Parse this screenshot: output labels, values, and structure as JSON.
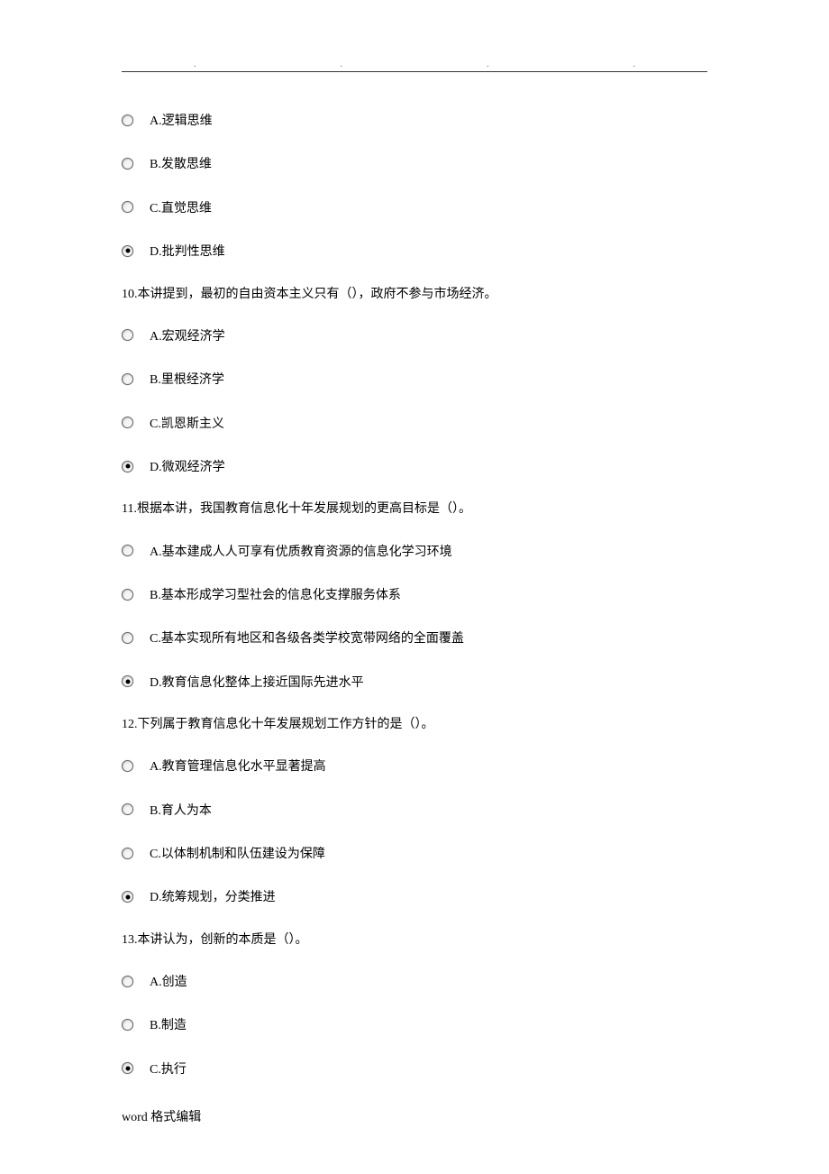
{
  "header_dots": [
    ".",
    ".",
    ".",
    "."
  ],
  "questions": [
    {
      "text": "",
      "options": [
        {
          "label": "A.逻辑思维",
          "selected": false
        },
        {
          "label": "B.发散思维",
          "selected": false
        },
        {
          "label": "C.直觉思维",
          "selected": false
        },
        {
          "label": "D.批判性思维",
          "selected": true
        }
      ]
    },
    {
      "text": "10.本讲提到，最初的自由资本主义只有（），政府不参与市场经济。",
      "options": [
        {
          "label": "A.宏观经济学",
          "selected": false
        },
        {
          "label": "B.里根经济学",
          "selected": false
        },
        {
          "label": "C.凯恩斯主义",
          "selected": false
        },
        {
          "label": "D.微观经济学",
          "selected": true
        }
      ]
    },
    {
      "text": "11.根据本讲，我国教育信息化十年发展规划的更高目标是（）。",
      "options": [
        {
          "label": "A.基本建成人人可享有优质教育资源的信息化学习环境",
          "selected": false
        },
        {
          "label": "B.基本形成学习型社会的信息化支撑服务体系",
          "selected": false
        },
        {
          "label": "C.基本实现所有地区和各级各类学校宽带网络的全面覆盖",
          "selected": false
        },
        {
          "label": "D.教育信息化整体上接近国际先进水平",
          "selected": true
        }
      ]
    },
    {
      "text": "12.下列属于教育信息化十年发展规划工作方针的是（）。",
      "options": [
        {
          "label": "A.教育管理信息化水平显著提高",
          "selected": false
        },
        {
          "label": "B.育人为本",
          "selected": false
        },
        {
          "label": "C.以体制机制和队伍建设为保障",
          "selected": false
        },
        {
          "label": "D.统筹规划，分类推进",
          "selected": true
        }
      ]
    },
    {
      "text": "13.本讲认为，创新的本质是（）。",
      "options": [
        {
          "label": "A.创造",
          "selected": false
        },
        {
          "label": "B.制造",
          "selected": false
        },
        {
          "label": "C.执行",
          "selected": true
        }
      ]
    }
  ],
  "footer": "word 格式编辑"
}
